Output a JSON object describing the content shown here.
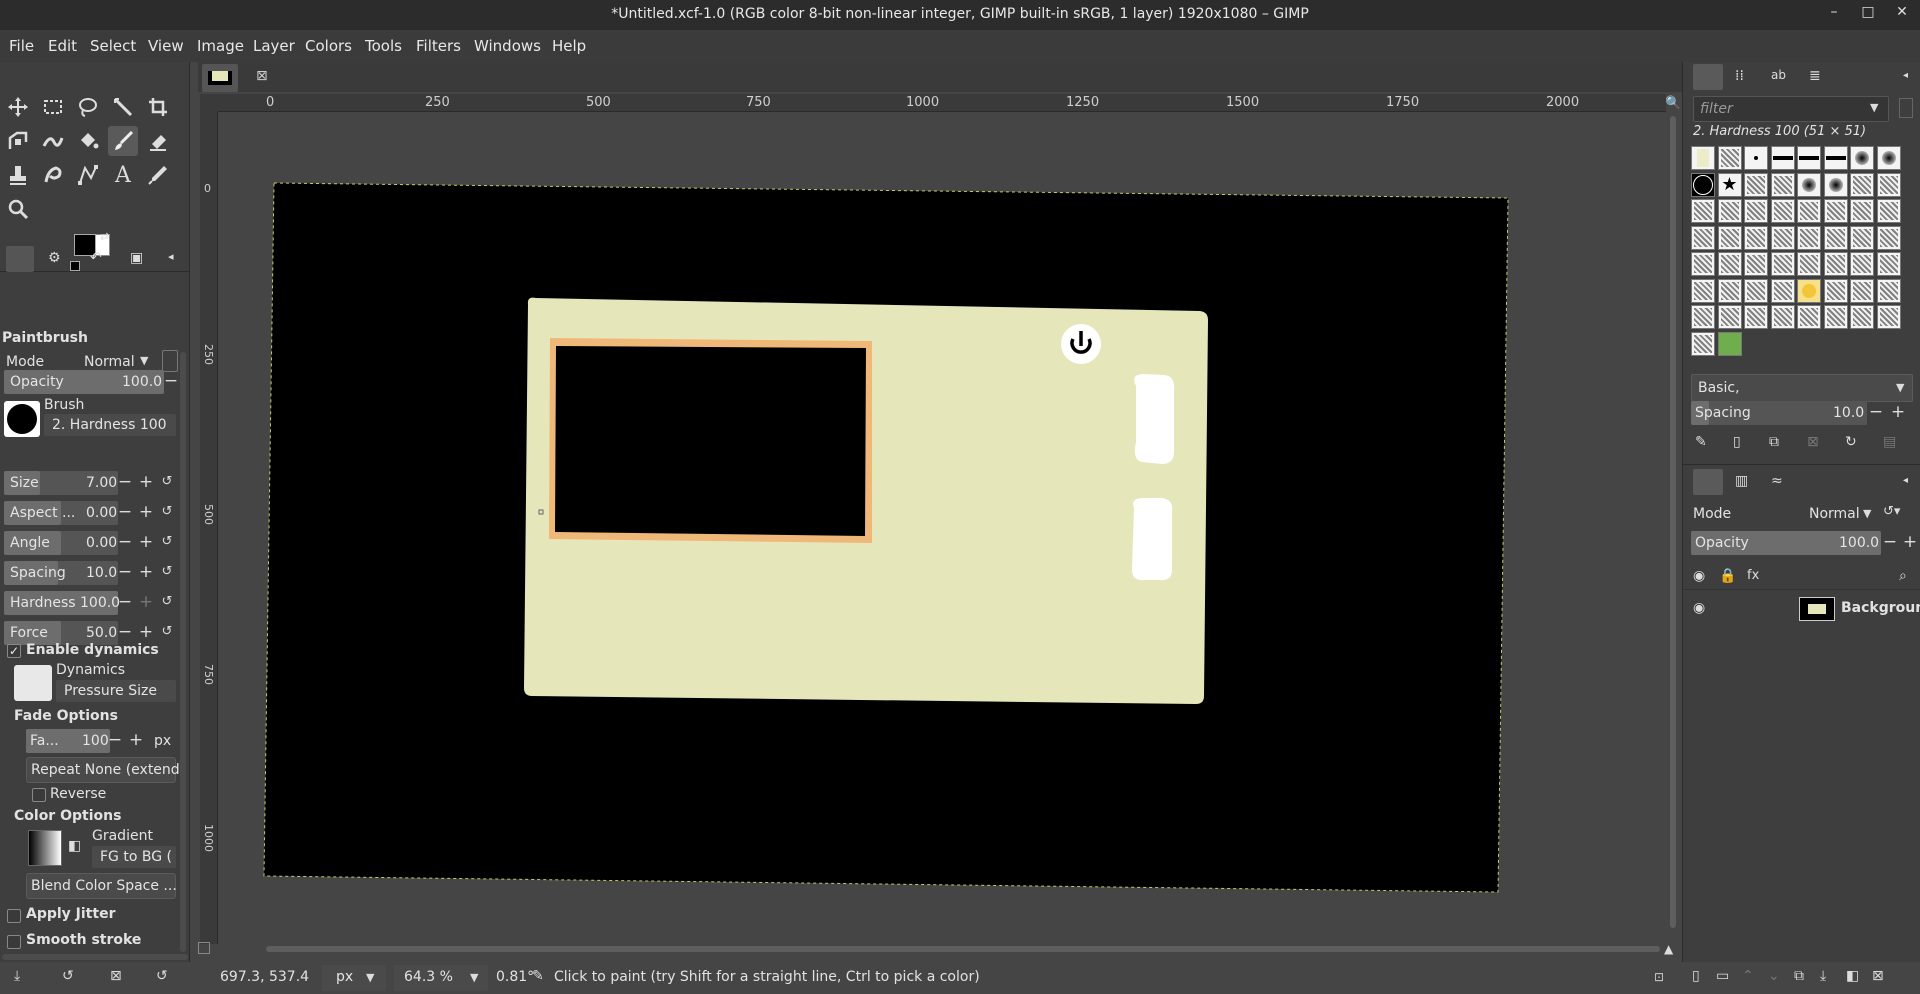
{
  "window": {
    "title": "*Untitled.xcf-1.0 (RGB color 8-bit non-linear integer, GIMP built-in sRGB, 1 layer) 1920x1080 – GIMP",
    "minimize_icon": "minimize-icon",
    "maximize_icon": "maximize-icon",
    "close_icon": "close-icon"
  },
  "menu": [
    "File",
    "Edit",
    "Select",
    "View",
    "Image",
    "Layer",
    "Colors",
    "Tools",
    "Filters",
    "Windows",
    "Help"
  ],
  "rulers": {
    "horizontal": [
      "0",
      "250",
      "500",
      "750",
      "1000",
      "1250",
      "1500",
      "1750",
      "2000"
    ],
    "vertical": [
      "0",
      "250",
      "500",
      "750",
      "1000"
    ]
  },
  "tool_options": {
    "title": "Paintbrush",
    "mode_label": "Mode",
    "mode_value": "Normal",
    "opacity_label": "Opacity",
    "opacity_value": "100.0",
    "brush_label": "Brush",
    "brush_name": "2. Hardness 100",
    "size_label": "Size",
    "size_value": "7.00",
    "aspect_label": "Aspect ...",
    "aspect_value": "0.00",
    "angle_label": "Angle",
    "angle_value": "0.00",
    "spacing_label": "Spacing",
    "spacing_value": "10.0",
    "hardness_label": "Hardness",
    "hardness_value": "100.0",
    "force_label": "Force",
    "force_value": "50.0",
    "enable_dynamics": "Enable dynamics",
    "dynamics_label": "Dynamics",
    "dynamics_value": "Pressure Size",
    "fade_options": "Fade Options",
    "fade_label": "Fa...",
    "fade_value": "100",
    "fade_unit": "px",
    "repeat_value": "Repeat None (extend)",
    "reverse_label": "Reverse",
    "color_options": "Color Options",
    "gradient_label": "Gradient",
    "gradient_value": "FG to BG (",
    "blend_space": "Blend Color Space ...",
    "apply_jitter": "Apply Jitter",
    "smooth_stroke": "Smooth stroke"
  },
  "brushes_panel": {
    "filter_placeholder": "filter",
    "selected_brush": "2. Hardness 100 (51 × 51)",
    "preset": "Basic,",
    "spacing_label": "Spacing",
    "spacing_value": "10.0"
  },
  "layers_panel": {
    "mode_label": "Mode",
    "mode_value": "Normal",
    "opacity_label": "Opacity",
    "opacity_value": "100.0",
    "layer_name": "Background"
  },
  "statusbar": {
    "coords": "697.3, 537.4",
    "unit": "px",
    "zoom": "64.3 %",
    "angle": "0.81°",
    "message": "Click to paint (try Shift for a straight line, Ctrl to pick a color)"
  },
  "colors": {
    "accent_active_tool": "#5a5a5a",
    "device_body": "#e6e6bb",
    "screen_frame": "#f0b878",
    "canvas_bg": "#000000"
  }
}
